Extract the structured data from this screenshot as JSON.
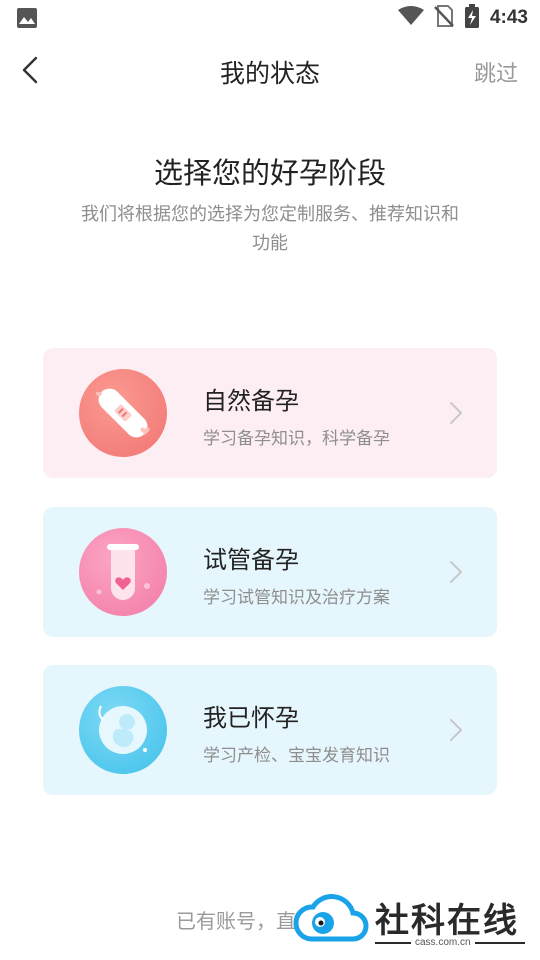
{
  "status_bar": {
    "time": "4:43",
    "icons": [
      "image-icon",
      "wifi-icon",
      "no-sim-icon",
      "battery-charging-icon"
    ]
  },
  "nav": {
    "title": "我的状态",
    "skip_label": "跳过",
    "back_icon": "chevron-left-icon"
  },
  "heading": {
    "title": "选择您的好孕阶段",
    "subtitle": "我们将根据您的选择为您定制服务、推荐知识和功能"
  },
  "options": [
    {
      "title": "自然备孕",
      "desc": "学习备孕知识，科学备孕",
      "icon": "pregnancy-test-icon",
      "bg": "#fdeef4",
      "accent": "#f27b7b"
    },
    {
      "title": "试管备孕",
      "desc": "学习试管知识及治疗方案",
      "icon": "test-tube-heart-icon",
      "bg": "#e6f6fd",
      "accent": "#f58ab0"
    },
    {
      "title": "我已怀孕",
      "desc": "学习产检、宝宝发育知识",
      "icon": "fetus-icon",
      "bg": "#e6f6fd",
      "accent": "#4fc8ec"
    }
  ],
  "footer": {
    "text": "已有账号，直"
  },
  "watermark": {
    "text": "社科在线",
    "sub": "cass.com.cn"
  }
}
